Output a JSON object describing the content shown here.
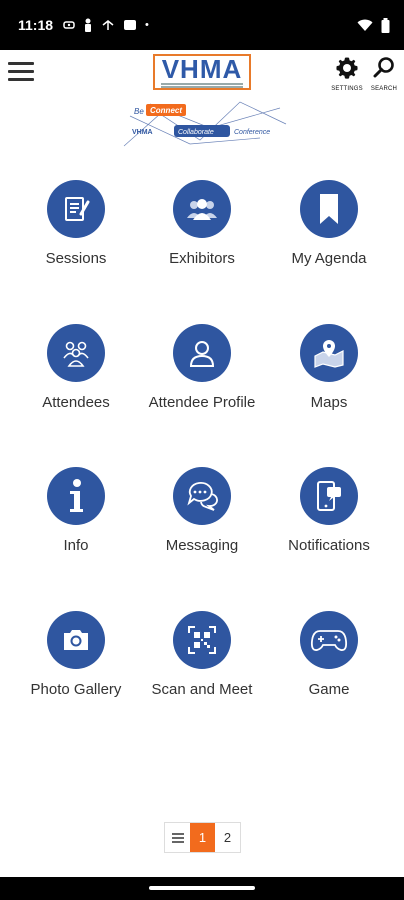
{
  "statusbar": {
    "time": "11:18",
    "indicators": [
      "sim-icon",
      "battery-icon",
      "signal-icon",
      "badge-icon"
    ],
    "dot": "•"
  },
  "header": {
    "logo_text": "VHMA",
    "settings_label": "SETTINGS",
    "search_label": "SEARCH",
    "banner": {
      "be": "Be",
      "connect": "Connect",
      "vhma": "VHMA",
      "collaborate": "Collaborate",
      "conference": "Conference"
    }
  },
  "tiles": [
    {
      "label": "Sessions",
      "icon": "sessions-icon"
    },
    {
      "label": "Exhibitors",
      "icon": "exhibitors-icon"
    },
    {
      "label": "My Agenda",
      "icon": "bookmark-icon"
    },
    {
      "label": "Attendees",
      "icon": "attendees-icon"
    },
    {
      "label": "Attendee Profile",
      "icon": "profile-icon"
    },
    {
      "label": "Maps",
      "icon": "map-icon"
    },
    {
      "label": "Info",
      "icon": "info-icon"
    },
    {
      "label": "Messaging",
      "icon": "messaging-icon"
    },
    {
      "label": "Notifications",
      "icon": "notifications-icon"
    },
    {
      "label": "Photo Gallery",
      "icon": "camera-icon"
    },
    {
      "label": "Scan and Meet",
      "icon": "qr-icon"
    },
    {
      "label": "Game",
      "icon": "gamepad-icon"
    }
  ],
  "pager": {
    "pages": [
      "1",
      "2"
    ],
    "current": "1"
  },
  "colors": {
    "accent": "#2f56a0",
    "active_page": "#f26b1d",
    "logo_border": "#e87a2a"
  }
}
